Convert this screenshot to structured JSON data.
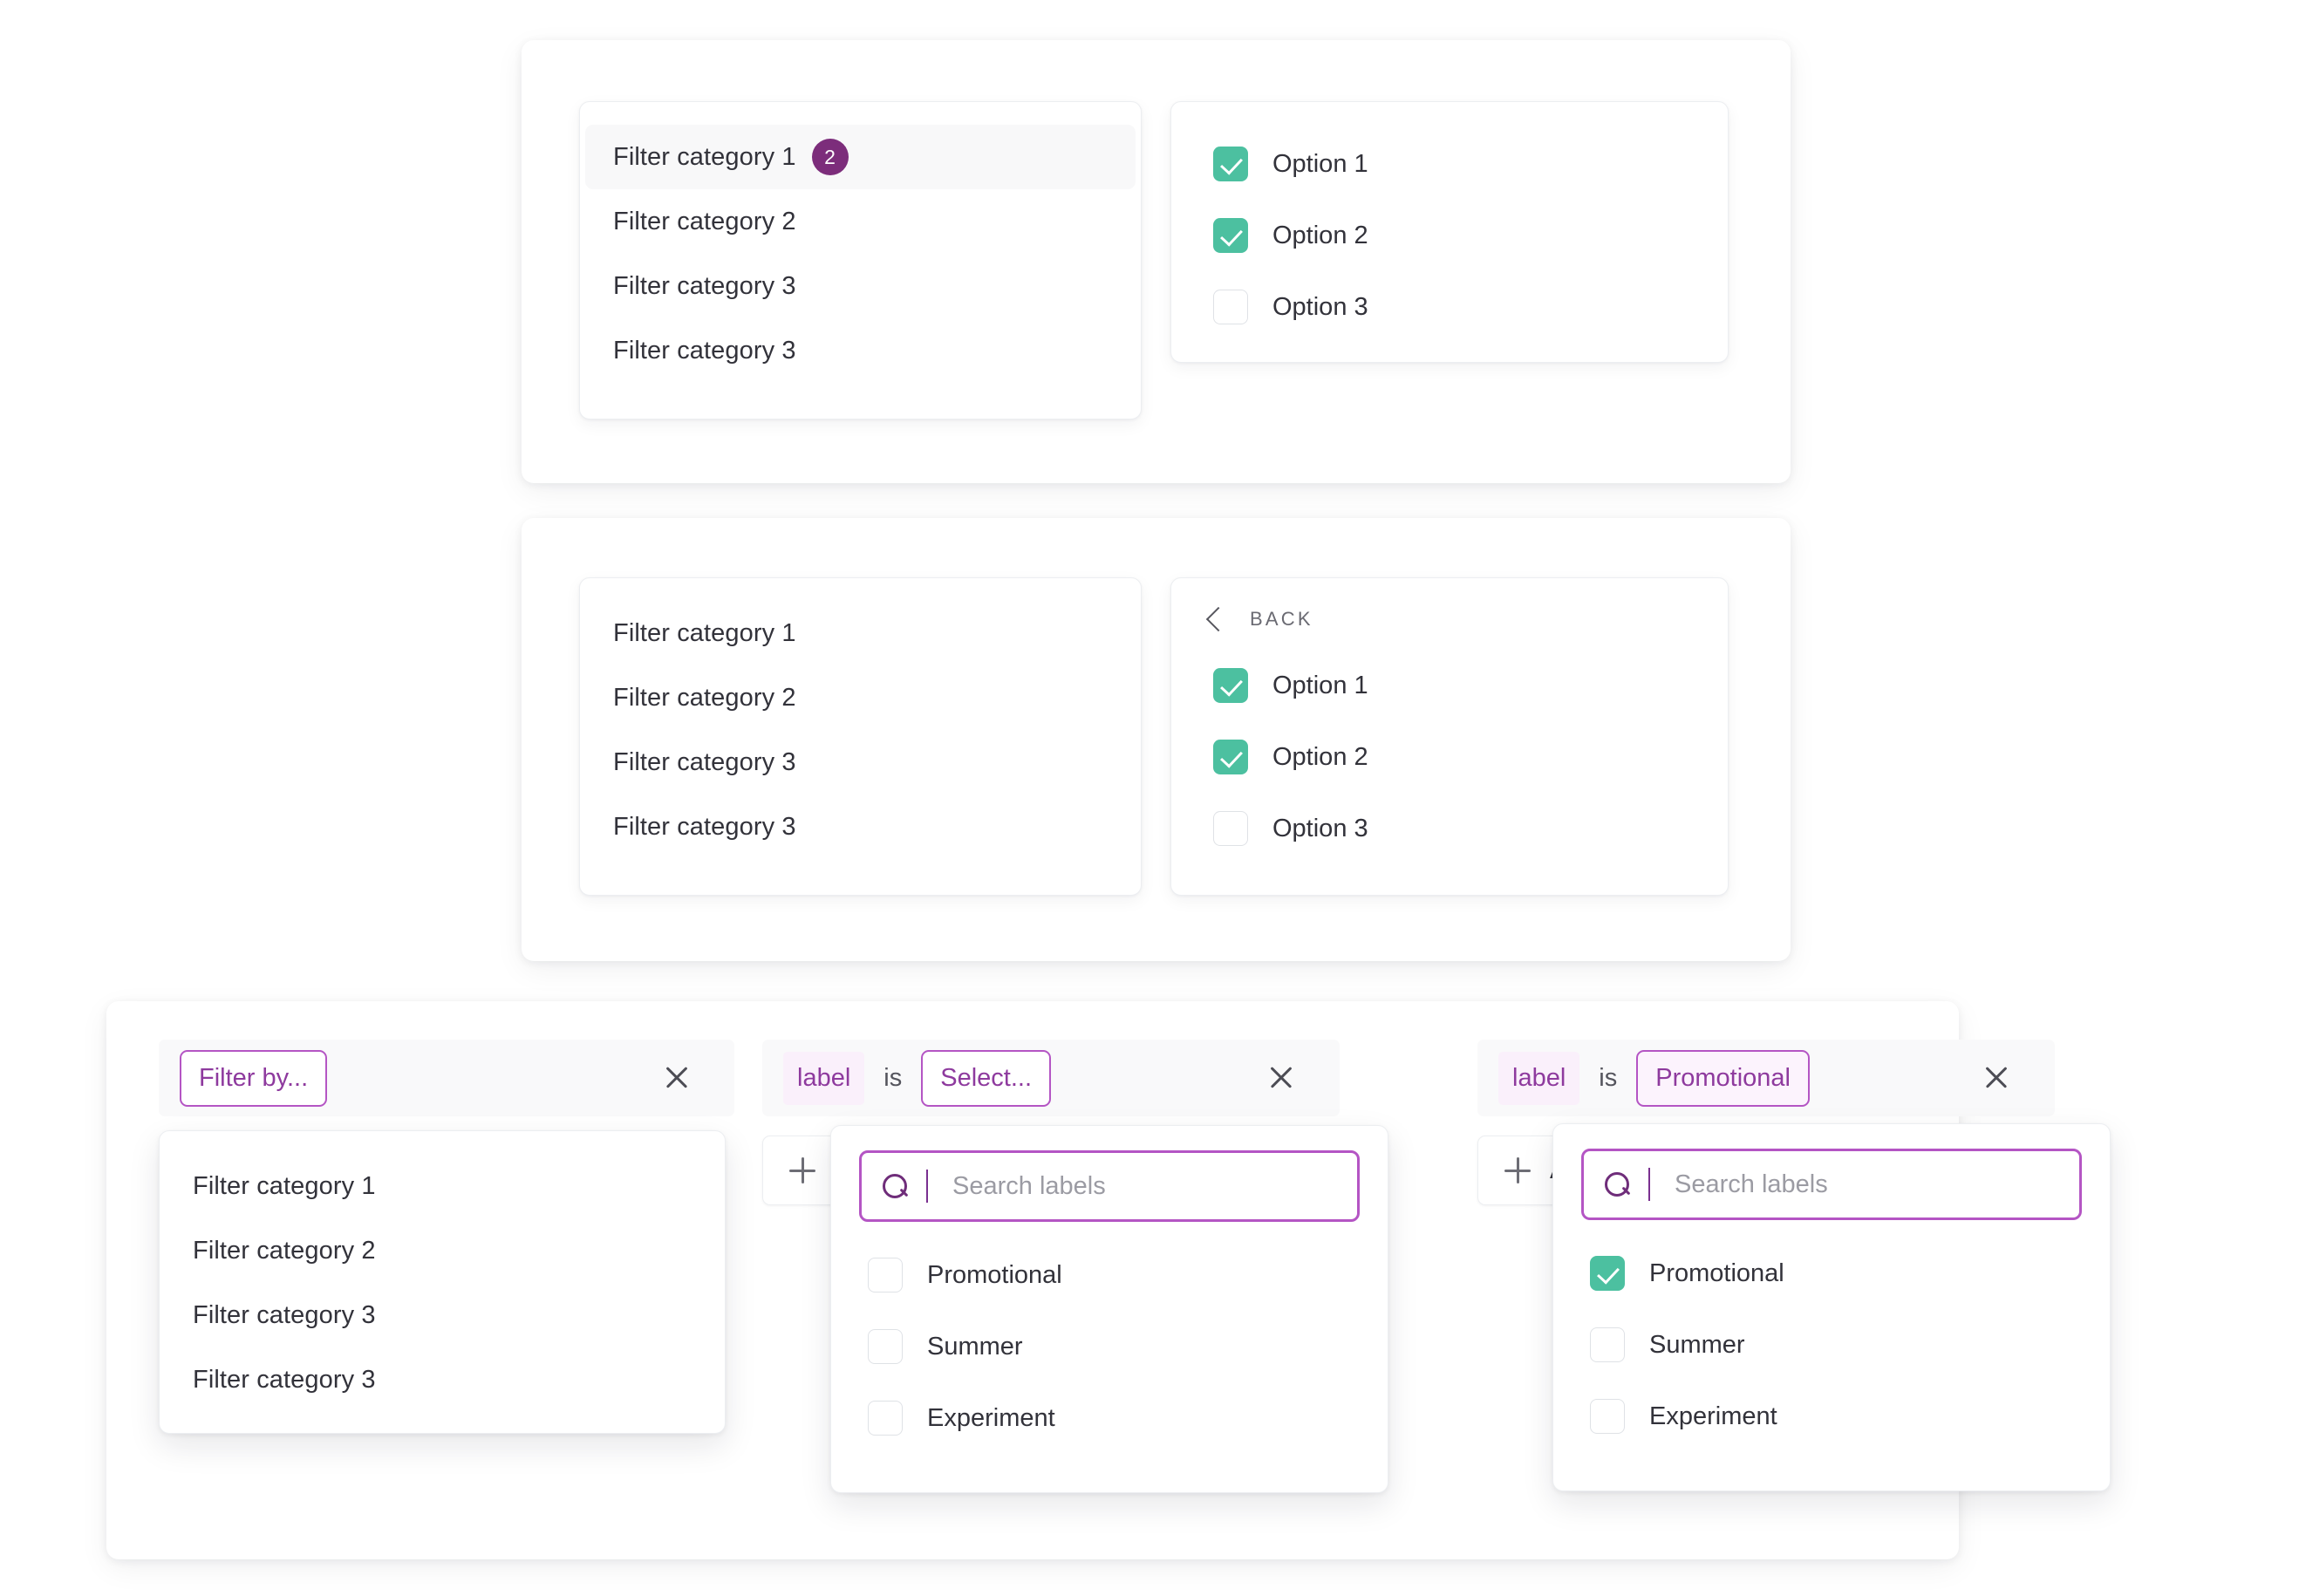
{
  "theme": {
    "accent_purple": "#8e3a9e",
    "accent_purple_border": "#b455c4",
    "badge_purple": "#7c2d7b",
    "checkbox_green": "#4cc0a0",
    "chip_bg": "#faf0fb",
    "row_bg": "#f9f9fa"
  },
  "card_one": {
    "categories": [
      {
        "label": "Filter category 1",
        "badge": "2",
        "active": true
      },
      {
        "label": "Filter category 2",
        "badge": "",
        "active": false
      },
      {
        "label": "Filter category 3",
        "badge": "",
        "active": false
      },
      {
        "label": "Filter category 3",
        "badge": "",
        "active": false
      }
    ],
    "options": [
      {
        "label": "Option 1",
        "checked": true
      },
      {
        "label": "Option 2",
        "checked": true
      },
      {
        "label": "Option 3",
        "checked": false
      }
    ]
  },
  "card_two": {
    "categories": [
      {
        "label": "Filter category 1",
        "badge": "",
        "active": false
      },
      {
        "label": "Filter category 2",
        "badge": "",
        "active": false
      },
      {
        "label": "Filter category 3",
        "badge": "",
        "active": false
      },
      {
        "label": "Filter category 3",
        "badge": "",
        "active": false
      }
    ],
    "back_label": "Back",
    "options": [
      {
        "label": "Option 1",
        "checked": true
      },
      {
        "label": "Option 2",
        "checked": true
      },
      {
        "label": "Option 3",
        "checked": false
      }
    ]
  },
  "builder": {
    "group_one": {
      "trigger_label": "Filter by...",
      "categories": [
        "Filter category 1",
        "Filter category 2",
        "Filter category 3",
        "Filter category 3"
      ]
    },
    "group_two": {
      "key_label": "label",
      "operator_label": "is",
      "value_label": "Select...",
      "add_filter_label": "Add filter",
      "search_placeholder": "Search labels",
      "search_value": "",
      "labels": [
        {
          "label": "Promotional",
          "checked": false
        },
        {
          "label": "Summer",
          "checked": false
        },
        {
          "label": "Experiment",
          "checked": false
        }
      ]
    },
    "group_three": {
      "key_label": "label",
      "operator_label": "is",
      "value_label": "Promotional",
      "add_filter_label": "Add filter",
      "search_placeholder": "Search labels",
      "search_value": "",
      "labels": [
        {
          "label": "Promotional",
          "checked": true
        },
        {
          "label": "Summer",
          "checked": false
        },
        {
          "label": "Experiment",
          "checked": false
        }
      ]
    }
  }
}
